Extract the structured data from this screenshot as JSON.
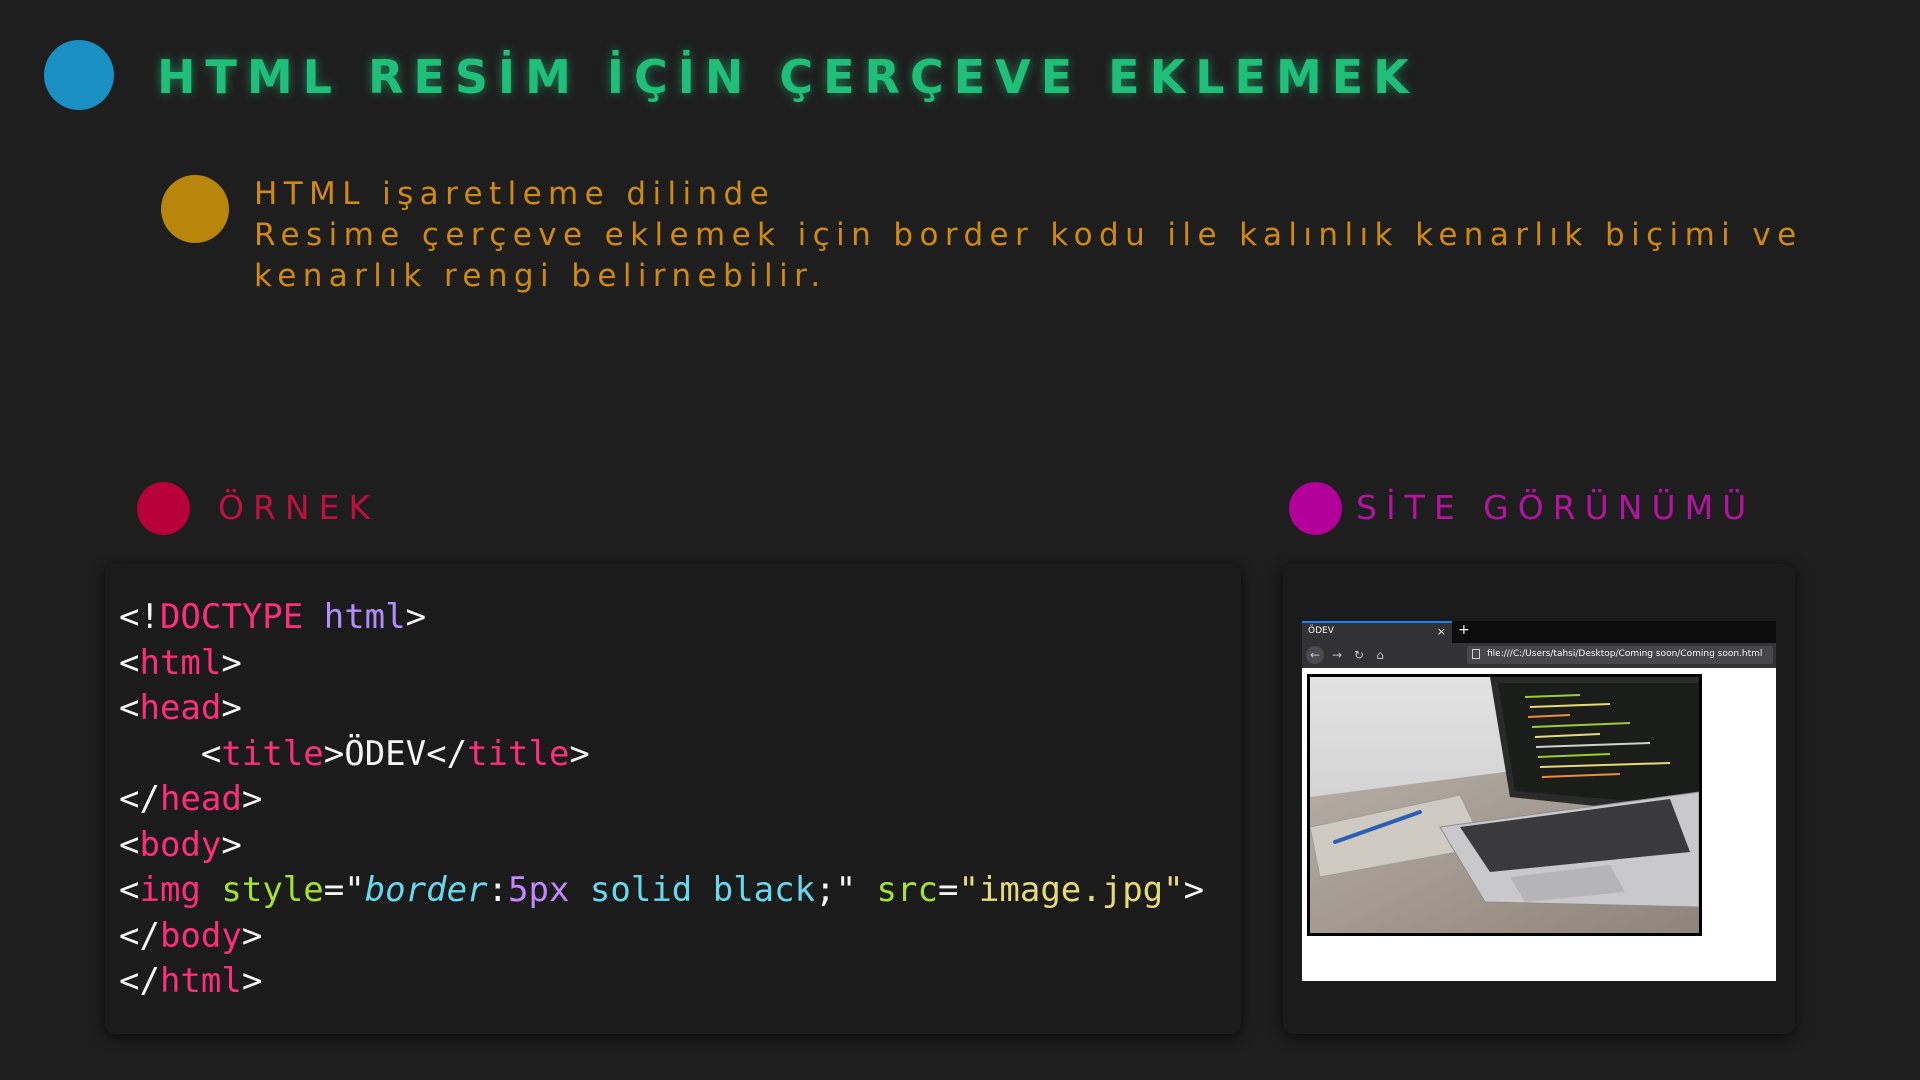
{
  "title": "HTML RESİM İÇİN ÇERÇEVE EKLEMEK",
  "description": {
    "lines": [
      "HTML işaretleme dilinde",
      "Resime çerçeve eklemek için border kodu ile kalınlık kenarlık biçimi ve",
      "kenarlık rengi belirnebilir."
    ]
  },
  "sections": {
    "example_label": "ÖRNEK",
    "site_label": "SİTE GÖRÜNÜMÜ"
  },
  "code": {
    "doctype_keyword": "DOCTYPE",
    "doctype_value": "html",
    "tags": {
      "html": "html",
      "head": "head",
      "title": "title",
      "body": "body",
      "img": "img"
    },
    "title_text": "ÖDEV",
    "img_attr_style": "style",
    "img_prop": "border",
    "img_num": "5px",
    "img_rest": "solid black",
    "img_attr_src": "src",
    "img_src_value": "\"image.jpg\""
  },
  "browser": {
    "tab_title": "ÖDEV",
    "tab_close": "×",
    "new_tab": "+",
    "url": "file:///C:/Users/tahsi/Desktop/Coming soon/Coming soon.html"
  },
  "colors": {
    "title": "#1fbf7a",
    "description": "#d08a10",
    "dot_blue": "#1a8fc2",
    "dot_orange": "#b8860b",
    "dot_red": "#b8003a",
    "dot_magenta": "#b3009b",
    "label_red": "#c0103f",
    "label_magenta": "#b514a0"
  }
}
